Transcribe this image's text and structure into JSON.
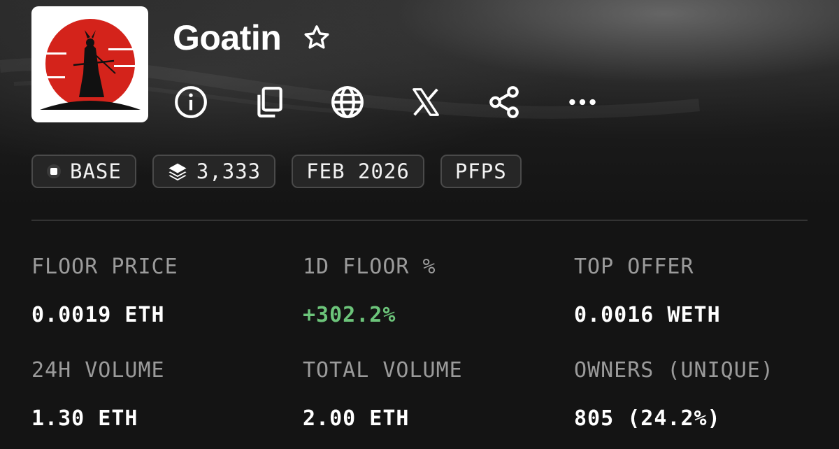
{
  "collection": {
    "name": "Goatin",
    "favorite_icon": "star-outline-icon",
    "action_icons": [
      "info-icon",
      "copy-icon",
      "globe-icon",
      "x-icon",
      "share-icon",
      "more-icon"
    ]
  },
  "tags": {
    "chain": "BASE",
    "supply": "3,333",
    "date": "FEB 2026",
    "category": "PFPS"
  },
  "stats": {
    "floor_price": {
      "label": "FLOOR PRICE",
      "value": "0.0019 ETH"
    },
    "floor_change": {
      "label": "1D FLOOR %",
      "value": "+302.2%"
    },
    "top_offer": {
      "label": "TOP OFFER",
      "value": "0.0016 WETH"
    },
    "volume_24h": {
      "label": "24H VOLUME",
      "value": "1.30 ETH"
    },
    "total_volume": {
      "label": "TOTAL VOLUME",
      "value": "2.00 ETH"
    },
    "owners": {
      "label": "OWNERS (UNIQUE)",
      "value": "805 (24.2%)"
    }
  },
  "colors": {
    "background": "#141414",
    "positive": "#6cc47a",
    "logo_sun": "#d4231b"
  }
}
